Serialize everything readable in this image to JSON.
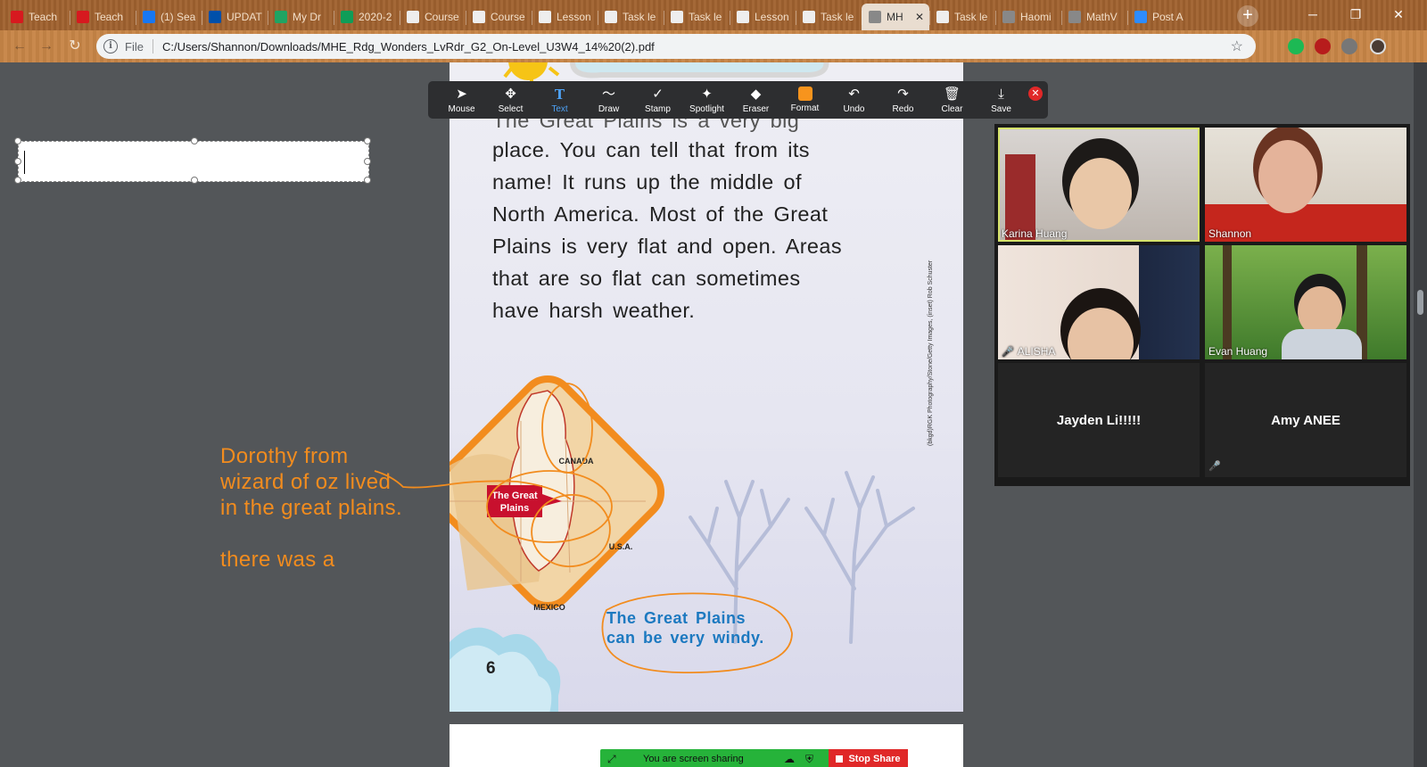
{
  "browser": {
    "tabs": [
      {
        "title": "Teach",
        "icon": "teachingstrategies-icon",
        "color": "#d7191f"
      },
      {
        "title": "Teach",
        "icon": "teachingstrategies-icon",
        "color": "#d7191f"
      },
      {
        "title": "(1) Sea",
        "icon": "facebook-icon",
        "color": "#1877f2"
      },
      {
        "title": "UPDAT",
        "icon": "lidl-icon",
        "color": "#0050aa"
      },
      {
        "title": "My Dr",
        "icon": "google-drive-icon",
        "color": "#1fa463"
      },
      {
        "title": "2020-2",
        "icon": "google-sheets-icon",
        "color": "#0f9d58"
      },
      {
        "title": "Course",
        "icon": "document-icon",
        "color": "#eeeeee"
      },
      {
        "title": "Course",
        "icon": "document-icon",
        "color": "#eeeeee"
      },
      {
        "title": "Lesson",
        "icon": "document-icon",
        "color": "#eeeeee"
      },
      {
        "title": "Task le",
        "icon": "document-icon",
        "color": "#eeeeee"
      },
      {
        "title": "Task le",
        "icon": "document-icon",
        "color": "#eeeeee"
      },
      {
        "title": "Lesson",
        "icon": "document-icon",
        "color": "#eeeeee"
      },
      {
        "title": "Task le",
        "icon": "document-icon",
        "color": "#eeeeee"
      },
      {
        "title": "MH",
        "icon": "globe-icon",
        "color": "#888888",
        "active": true
      },
      {
        "title": "Task le",
        "icon": "document-icon",
        "color": "#eeeeee"
      },
      {
        "title": "Haomi",
        "icon": "globe-icon",
        "color": "#888888"
      },
      {
        "title": "MathV",
        "icon": "globe-icon",
        "color": "#888888"
      },
      {
        "title": "Post A",
        "icon": "zoom-icon",
        "color": "#2d8cff"
      }
    ],
    "new_tab_label": "+",
    "window_controls": [
      "─",
      "❐",
      "✕"
    ],
    "address": {
      "scheme_label": "File",
      "url": "C:/Users/Shannon/Downloads/MHE_Rdg_Wonders_LvRdr_G2_On-Level_U3W4_14%20(2).pdf"
    },
    "extension_colors": [
      "#1db954",
      "#b71c1c",
      "#777777"
    ]
  },
  "annotate_toolbar": {
    "tools": [
      {
        "label": "Mouse",
        "icon": "mouse-pointer-icon",
        "glyph": "➤"
      },
      {
        "label": "Select",
        "icon": "select-move-icon",
        "glyph": "✥"
      },
      {
        "label": "Text",
        "icon": "text-icon",
        "glyph": "T",
        "active": true
      },
      {
        "label": "Draw",
        "icon": "draw-icon",
        "glyph": "〜"
      },
      {
        "label": "Stamp",
        "icon": "stamp-check-icon",
        "glyph": "✓"
      },
      {
        "label": "Spotlight",
        "icon": "spotlight-icon",
        "glyph": "✦"
      },
      {
        "label": "Eraser",
        "icon": "eraser-icon",
        "glyph": "◆"
      },
      {
        "label": "Format",
        "icon": "format-color-icon",
        "glyph": ""
      },
      {
        "label": "Undo",
        "icon": "undo-icon",
        "glyph": "↶"
      },
      {
        "label": "Redo",
        "icon": "redo-icon",
        "glyph": "↷"
      },
      {
        "label": "Clear",
        "icon": "trash-icon",
        "glyph": "🗑"
      },
      {
        "label": "Save",
        "icon": "save-icon",
        "glyph": "⤓"
      }
    ],
    "close_glyph": "✕",
    "accent_color": "#4ea2f5",
    "format_color": "#f7941d"
  },
  "pdf": {
    "passage_top_clipped": "The Great Plains is a very big",
    "passage": [
      "place. You can tell that from its",
      "name! It runs up the middle of",
      "North America. Most of the Great",
      "Plains is very flat and open. Areas",
      "that are so flat can sometimes",
      "have harsh weather."
    ],
    "map_labels": {
      "canada": "CANADA",
      "usa": "U.S.A.",
      "mexico": "MEXICO",
      "great_plains_line1": "The Great",
      "great_plains_line2": "Plains"
    },
    "caption_line1": "The Great Plains",
    "caption_line2": "can be very windy.",
    "page_number": "6",
    "photo_credit": "(bkgd)RGK Photography/Stone/Getty Images, (inset) Rob Schuster"
  },
  "annotations": {
    "note_lines": [
      "Dorothy from",
      "wizard of oz lived",
      "in the great plains.",
      "",
      "there was a"
    ],
    "ink_color": "#f28c1e"
  },
  "text_box": {
    "value": ""
  },
  "gallery": {
    "participants": [
      {
        "name": "Karina Huang",
        "video": true,
        "speaking": true,
        "muted": false
      },
      {
        "name": "Shannon",
        "video": true,
        "muted": false
      },
      {
        "name": "ALISHA",
        "video": true,
        "muted": true
      },
      {
        "name": "Evan Huang",
        "video": true,
        "muted": false
      },
      {
        "name": "Jayden Li!!!!!",
        "video": false,
        "muted": false
      },
      {
        "name": "Amy ANEE",
        "video": false,
        "muted": true
      }
    ]
  },
  "share_bar": {
    "status": "You are screen sharing",
    "stop_label": "Stop Share",
    "status_color": "#26b33a",
    "stop_color": "#e02828"
  }
}
